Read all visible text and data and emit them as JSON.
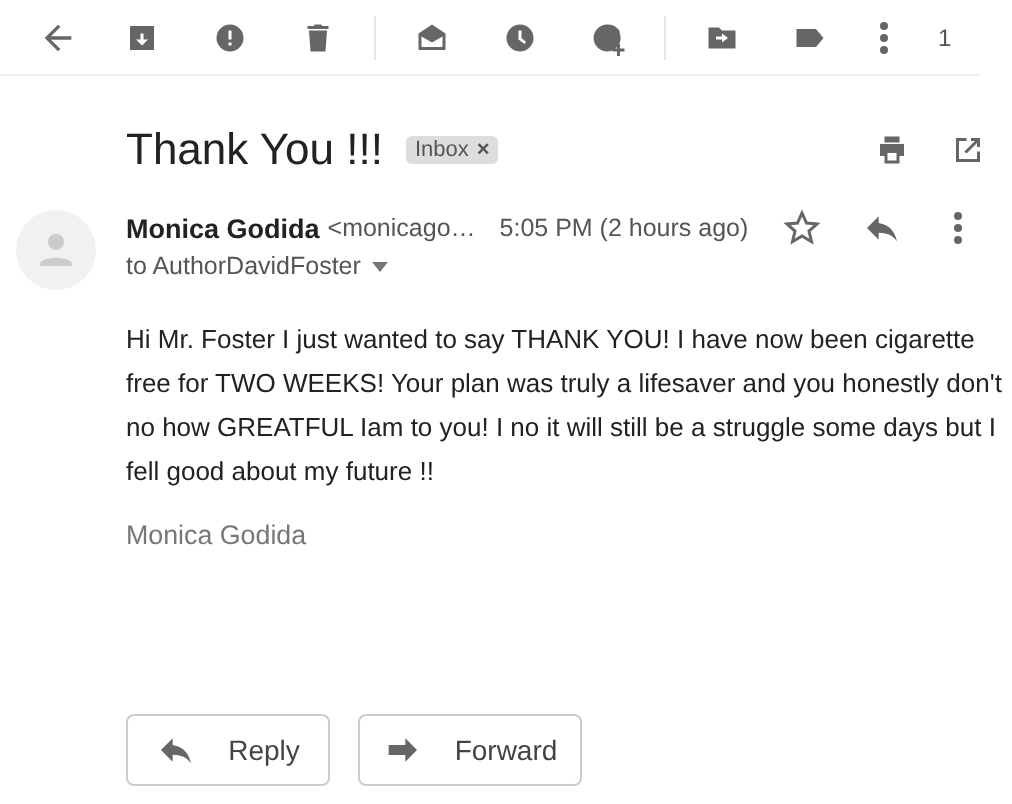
{
  "toolbar": {
    "page_counter": "1"
  },
  "message": {
    "subject": "Thank You !!!",
    "label": {
      "text": "Inbox",
      "remove": "×"
    },
    "sender_name": "Monica Godida",
    "sender_email": "<monicago…",
    "time": "5:05 PM (2 hours ago)",
    "starred": false,
    "recipient": "to AuthorDavidFoster",
    "body": "Hi Mr. Foster I just wanted to say THANK YOU! I have now been cigarette free for TWO WEEKS! Your plan was truly a lifesaver and you honestly don't no how GREATFUL Iam to you! I no it will still be a struggle some days but I fell good about my future !!",
    "signature": "Monica Godida"
  },
  "actions": [
    {
      "kind": "reply",
      "label": "Reply"
    },
    {
      "kind": "forward",
      "label": "Forward"
    }
  ]
}
